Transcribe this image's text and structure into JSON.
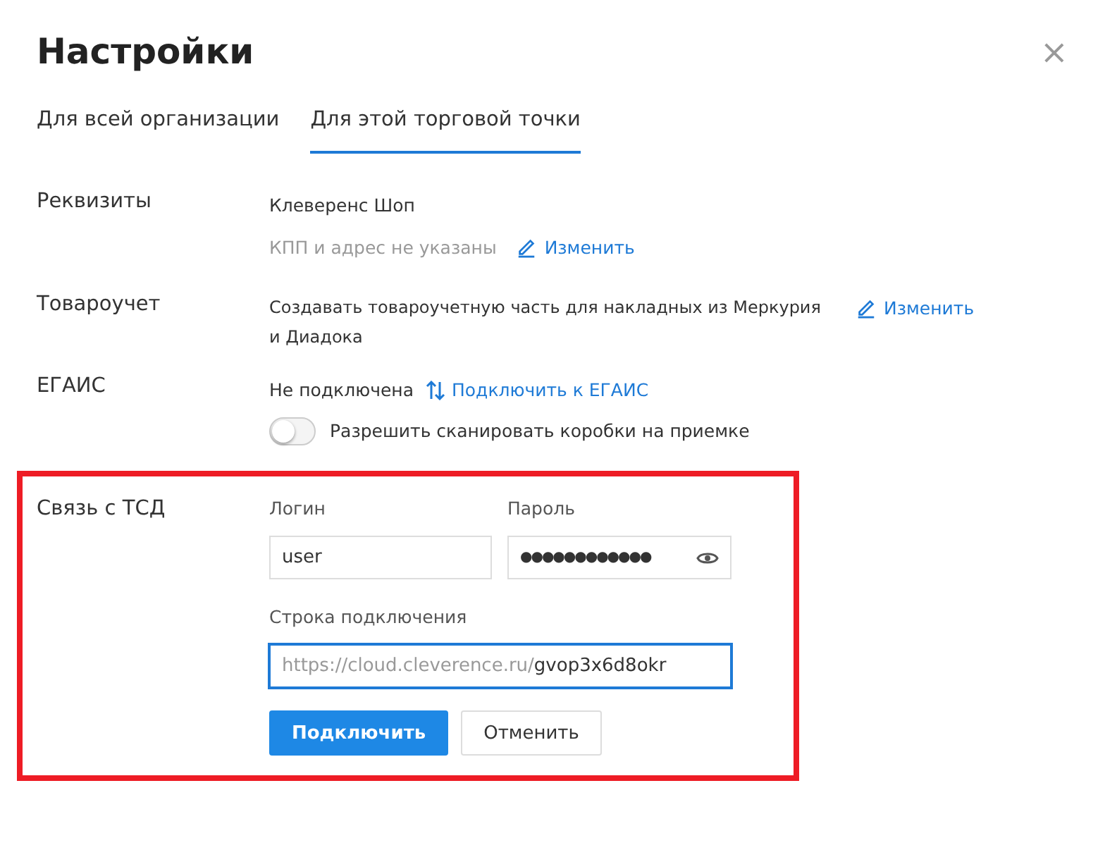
{
  "dialog": {
    "title": "Настройки",
    "close": "×"
  },
  "tabs": [
    {
      "label": "Для всей организации",
      "selected": false
    },
    {
      "label": "Для этой торговой точки",
      "selected": true
    }
  ],
  "requisites": {
    "label": "Реквизиты",
    "name": "Клеверенс Шоп",
    "note": "КПП и адрес не указаны",
    "edit_link": "Изменить"
  },
  "accounting": {
    "label": "Товароучет",
    "text": "Создавать товароучетную часть для накладных из Меркурия и Диадока",
    "edit_link": "Изменить"
  },
  "egais": {
    "label": "ЕГАИС",
    "status": "Не подключена",
    "connect_link": "Подключить к ЕГАИС",
    "toggle": {
      "label": "Разрешить сканировать коробки на приемке",
      "on": false
    }
  },
  "tsd": {
    "label": "Связь с ТСД",
    "highlighted": true,
    "login": {
      "label": "Логин",
      "value": "user"
    },
    "password": {
      "label": "Пароль",
      "value": "●●●●●●●●●●●●"
    },
    "connection": {
      "label": "Строка подключения",
      "prefix": "https://cloud.cleverence.ru/",
      "value": "gvop3x6d8okr",
      "focused": true
    },
    "buttons": [
      {
        "label": "Подключить",
        "kind": "primary"
      },
      {
        "label": "Отменить",
        "kind": "secondary"
      }
    ]
  }
}
